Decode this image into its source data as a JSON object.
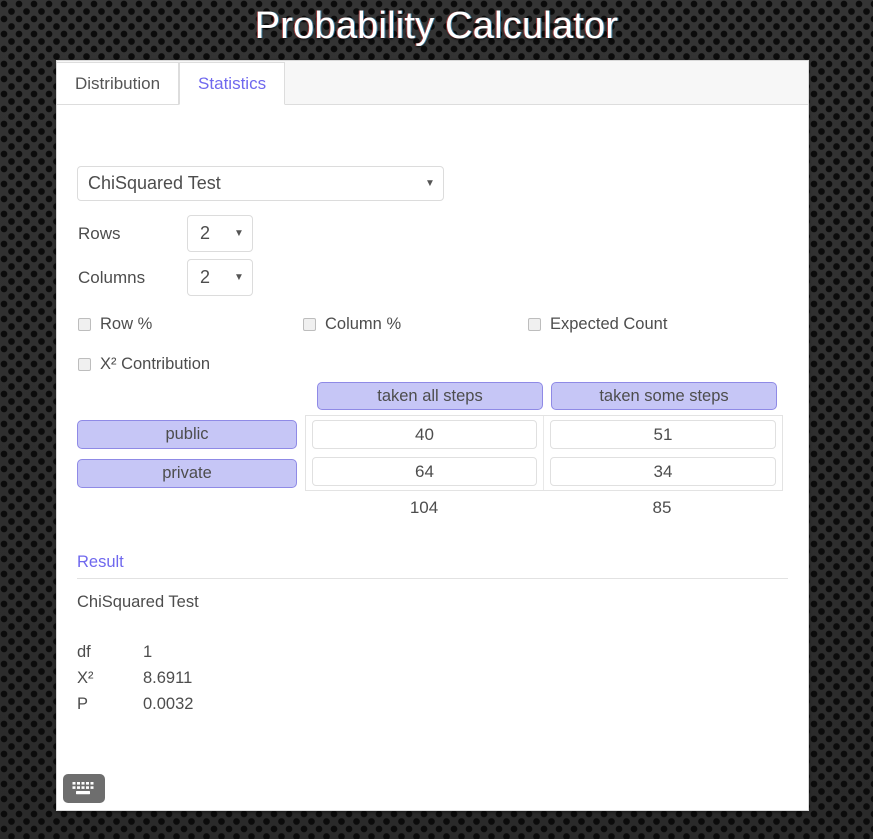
{
  "header": {
    "title": "Probability Calculator"
  },
  "tabs": [
    {
      "label": "Distribution",
      "active": false
    },
    {
      "label": "Statistics",
      "active": true
    }
  ],
  "controls": {
    "test_select": {
      "value": "ChiSquared Test",
      "caret": "chevron-down-icon"
    },
    "rows": {
      "label": "Rows",
      "value": "2"
    },
    "columns": {
      "label": "Columns",
      "value": "2"
    }
  },
  "options": [
    {
      "label": "Row %",
      "checked": false
    },
    {
      "label": "Column %",
      "checked": false
    },
    {
      "label": "Expected Count",
      "checked": false
    },
    {
      "label": "X² Contribution",
      "checked": false
    }
  ],
  "crosstab": {
    "column_headers": [
      "taken all steps",
      "taken some steps"
    ],
    "row_headers": [
      "public",
      "private"
    ],
    "cells": [
      [
        "40",
        "51"
      ],
      [
        "64",
        "34"
      ]
    ],
    "column_totals": [
      "104",
      "85"
    ]
  },
  "result": {
    "title": "Result",
    "subtitle": "ChiSquared Test",
    "rows": [
      {
        "key": "df",
        "value": "1"
      },
      {
        "key": "X²",
        "value": "8.6911"
      },
      {
        "key": "P",
        "value": "0.0032"
      }
    ]
  },
  "footer": {
    "keyboard_button": "keyboard-icon"
  },
  "colors": {
    "accent": "#6f68ee",
    "pill_fill": "#c6c6f6",
    "pill_border": "#8f8ae6",
    "text": "#4d4d4d",
    "panel_bg": "#ffffff",
    "tabstrip_bg": "#f7f7f7"
  }
}
